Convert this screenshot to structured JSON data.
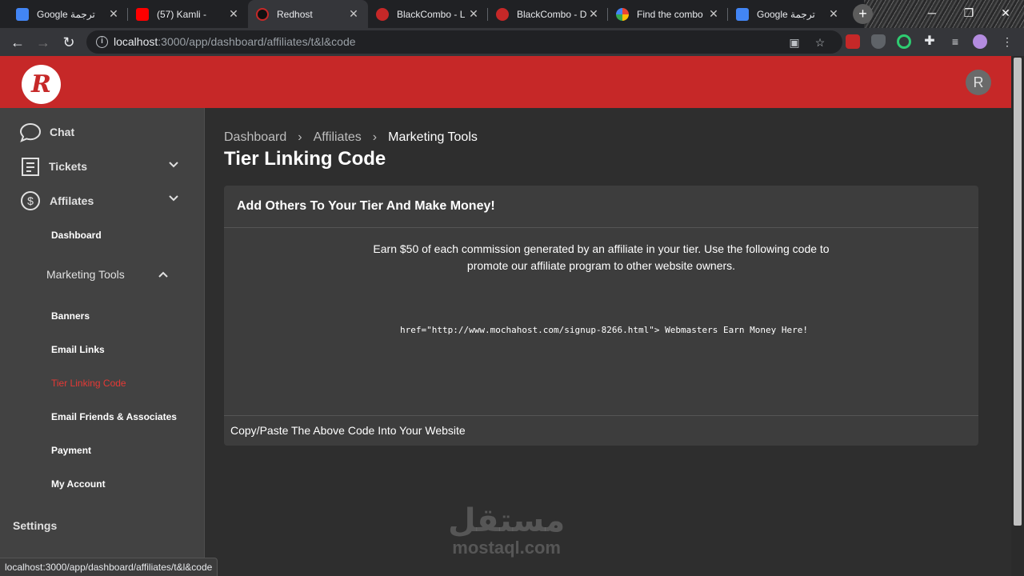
{
  "browser": {
    "tabs": [
      {
        "title": "Google ترجمة",
        "favicon": "google-translate-icon"
      },
      {
        "title": "(57) Kamli -",
        "favicon": "youtube-icon"
      },
      {
        "title": "Redhost",
        "favicon": "redhost-icon"
      },
      {
        "title": "BlackCombo - L",
        "favicon": "blackcombo-icon"
      },
      {
        "title": "BlackCombo - D",
        "favicon": "blackcombo-icon"
      },
      {
        "title": "Find the combo",
        "favicon": "google-icon"
      },
      {
        "title": "Google ترجمة",
        "favicon": "google-translate-icon"
      }
    ],
    "url_host": "localhost",
    "url_path": ":3000/app/dashboard/affiliates/t&l&code",
    "status_url": "localhost:3000/app/dashboard/affiliates/t&l&code"
  },
  "app": {
    "logo_letter": "R",
    "avatar_letter": "R",
    "brand_color": "#c62828"
  },
  "sidebar": {
    "chat": "Chat",
    "tickets": "Tickets",
    "affiliates": "Affilates",
    "affiliates_dashboard": "Dashboard",
    "marketing_tools": "Marketing Tools",
    "marketing_items": [
      {
        "label": "Banners"
      },
      {
        "label": "Email Links"
      },
      {
        "label": "Tier Linking Code",
        "active": true
      },
      {
        "label": "Email Friends & Associates"
      },
      {
        "label": "Payment"
      },
      {
        "label": "My Account"
      }
    ],
    "settings": "Settings"
  },
  "main": {
    "breadcrumb": [
      "Dashboard",
      "Affiliates",
      "Marketing Tools"
    ],
    "title": "Tier Linking Code",
    "card": {
      "heading": "Add Others To Your Tier And Make Money!",
      "description": "Earn $50 of each commission generated by an affiliate in your tier. Use the following code to promote our affiliate program to other website owners.",
      "code": "href=\"http://www.mochahost.com/signup-8266.html\"> Webmasters Earn Money Here!",
      "footer": "Copy/Paste The Above Code Into Your Website"
    }
  },
  "watermark": {
    "arabic": "مستقل",
    "latin": "mostaql.com"
  }
}
